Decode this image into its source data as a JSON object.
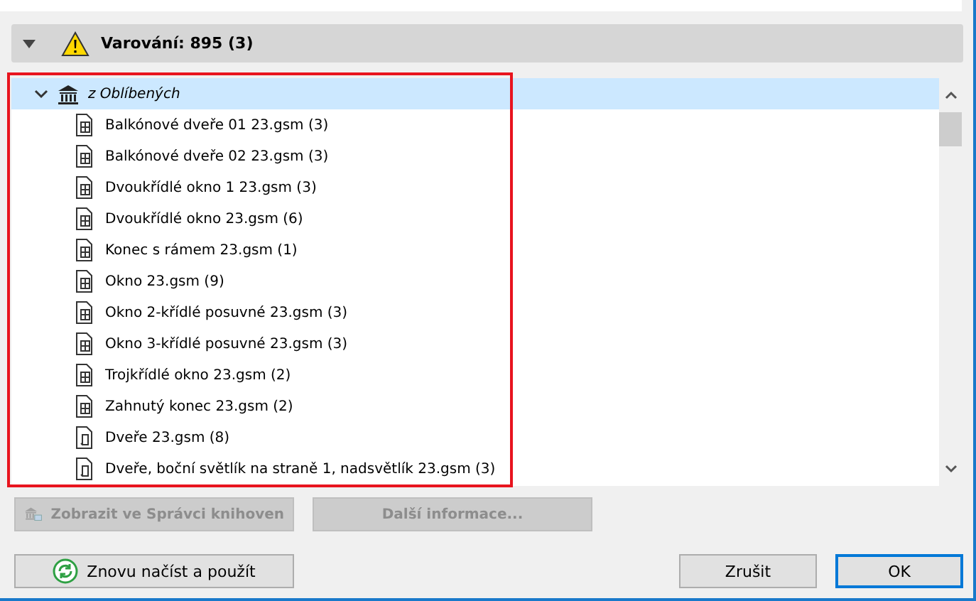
{
  "section": {
    "title": "Varování: 895 (3)",
    "expanded": true
  },
  "tree": [
    {
      "label": "z Oblíbených",
      "expanded": true,
      "selected": true,
      "children": [
        {
          "label": "Balkónové dveře 01 23.gsm (3)",
          "kind": "window",
          "selected": false
        },
        {
          "label": "Balkónové dveře 02 23.gsm (3)",
          "kind": "window",
          "selected": false
        },
        {
          "label": "Dvoukřídlé okno 1 23.gsm (3)",
          "kind": "window",
          "selected": false
        },
        {
          "label": "Dvoukřídlé okno 23.gsm (6)",
          "kind": "window",
          "selected": false
        },
        {
          "label": "Konec s rámem 23.gsm (1)",
          "kind": "window",
          "selected": false
        },
        {
          "label": "Okno 23.gsm (9)",
          "kind": "window",
          "selected": false
        },
        {
          "label": "Okno 2-křídlé posuvné 23.gsm (3)",
          "kind": "window",
          "selected": false
        },
        {
          "label": "Okno 3-křídlé posuvné 23.gsm (3)",
          "kind": "window",
          "selected": false
        },
        {
          "label": "Trojkřídlé okno 23.gsm (2)",
          "kind": "window",
          "selected": false
        },
        {
          "label": "Zahnutý konec 23.gsm (2)",
          "kind": "window",
          "selected": false
        },
        {
          "label": "Dveře 23.gsm (8)",
          "kind": "door",
          "selected": false
        },
        {
          "label": "Dveře, boční světlík na straně 1, nadsvětlík 23.gsm (3)",
          "kind": "door",
          "selected": false
        }
      ]
    }
  ],
  "actions": [
    {
      "label": "Zobrazit ve Správci knihoven",
      "kind": "library",
      "disabled": true
    },
    {
      "label": "Další informace...",
      "kind": "plain",
      "disabled": true
    }
  ],
  "footer": [
    {
      "label": "Znovu načíst a použít",
      "kind": "reload",
      "default": false
    },
    {
      "label": "Zrušit",
      "kind": "plain",
      "default": false
    },
    {
      "label": "OK",
      "kind": "plain",
      "default": true
    }
  ]
}
